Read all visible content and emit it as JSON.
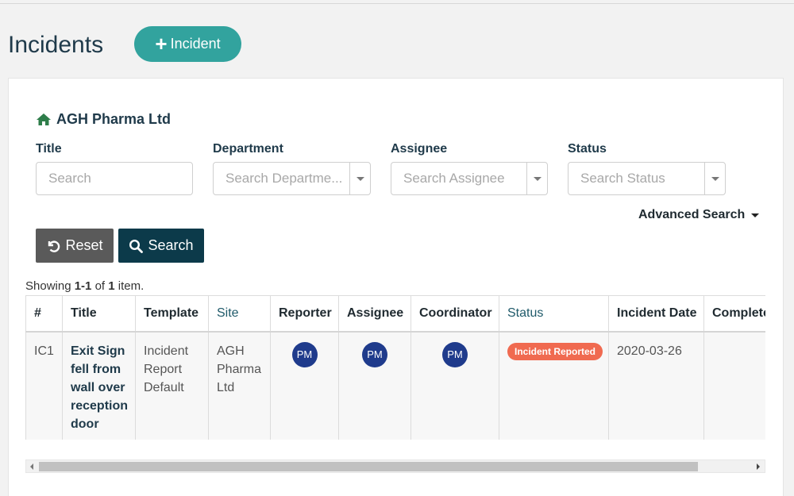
{
  "page": {
    "title": "Incidents",
    "add_button_label": "Incident"
  },
  "org": {
    "name": "AGH Pharma Ltd",
    "icon": "home-icon"
  },
  "filters": {
    "title": {
      "label": "Title",
      "placeholder": "Search"
    },
    "department": {
      "label": "Department",
      "placeholder": "Search Departme..."
    },
    "assignee": {
      "label": "Assignee",
      "placeholder": "Search Assignee"
    },
    "status": {
      "label": "Status",
      "placeholder": "Search Status"
    }
  },
  "advanced_search_label": "Advanced Search",
  "buttons": {
    "reset_label": "Reset",
    "search_label": "Search"
  },
  "summary": {
    "prefix": "Showing ",
    "range": "1-1",
    "middle": " of ",
    "total": "1",
    "suffix": " item."
  },
  "table": {
    "headers": {
      "num": "#",
      "title": "Title",
      "template": "Template",
      "site": "Site",
      "reporter": "Reporter",
      "assignee": "Assignee",
      "coordinator": "Coordinator",
      "status": "Status",
      "incident_date": "Incident Date",
      "completed": "Completed"
    },
    "rows": [
      {
        "num": "IC1",
        "title": "Exit Sign fell from wall over reception door",
        "template": "Incident Report Default",
        "site": "AGH Pharma Ltd",
        "reporter": "PM",
        "assignee": "PM",
        "coordinator": "PM",
        "status": "Incident Reported",
        "incident_date": "2020-03-26",
        "completed": ""
      }
    ]
  },
  "colors": {
    "accent": "#32a39e",
    "primary_dark": "#0c3a4a",
    "reset_gray": "#5a5a5a",
    "avatar_blue": "#1f3b8c",
    "status_reported": "#f06a50",
    "org_icon_green": "#2e7d4a"
  }
}
